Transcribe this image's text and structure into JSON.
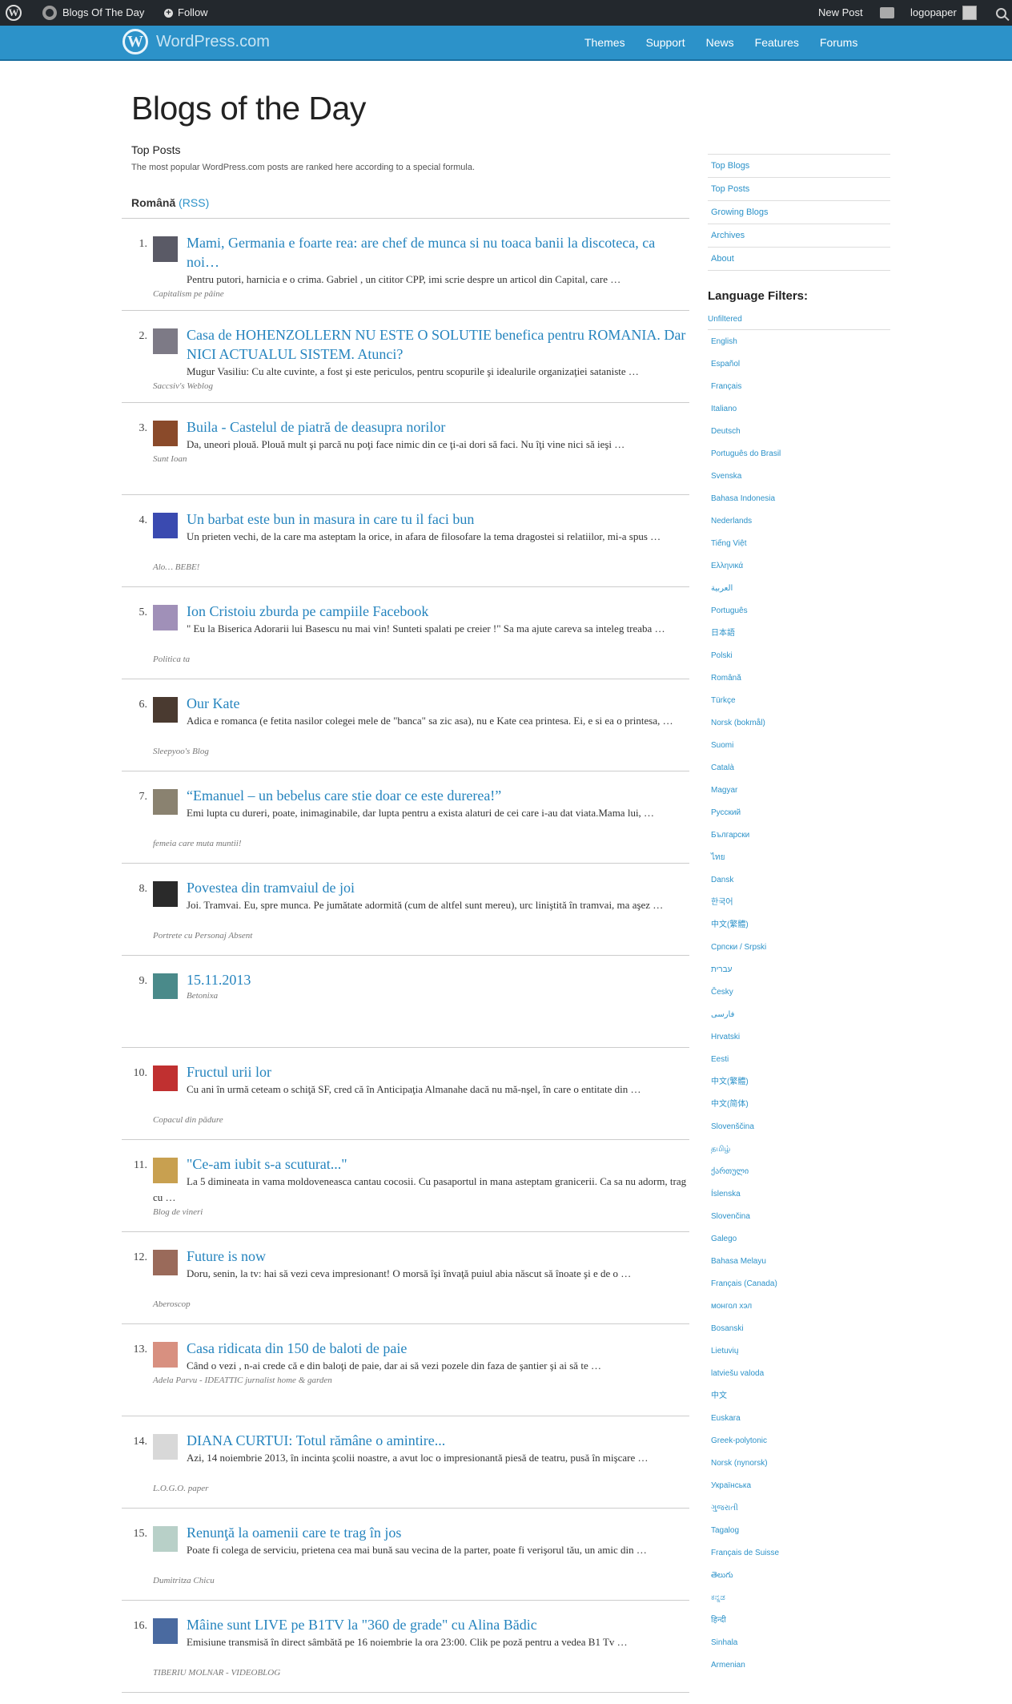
{
  "adminbar": {
    "site_name": "Blogs Of The Day",
    "follow": "Follow",
    "new_post": "New Post",
    "username": "logopaper"
  },
  "masthead": {
    "brand": "WordPress.com",
    "nav": [
      "Themes",
      "Support",
      "News",
      "Features",
      "Forums"
    ]
  },
  "main": {
    "title": "Blogs of the Day",
    "section_title": "Top Posts",
    "section_desc": "The most popular WordPress.com posts are ranked here according to a special formula.",
    "language": "Română",
    "rss": "(RSS)"
  },
  "colors": {
    "accent": "#2c92c9",
    "adminbar": "#23282d",
    "link": "#2584be"
  },
  "posts": [
    {
      "num": "1.",
      "title": "Mami, Germania e foarte rea: are chef de munca si nu toaca banii la discoteca, ca noi…",
      "excerpt": "Pentru putori, harnicia e o crima. Gabriel , un cititor CPP, imi scrie despre un articol din Capital, care …",
      "blog": "Capitalism pe pâine",
      "thumb": "#5a5a66"
    },
    {
      "num": "2.",
      "title": "Casa de HOHENZOLLERN NU ESTE O SOLUTIE benefica pentru ROMANIA. Dar NICI ACTUALUL SISTEM. Atunci?",
      "excerpt": "Mugur Vasiliu: Cu alte cuvinte, a fost şi este periculos, pentru scopurile şi idealurile organizaţiei sataniste …",
      "blog": "Saccsiv's Weblog",
      "thumb": "#7d7a86"
    },
    {
      "num": "3.",
      "title": "Buila - Castelul de piatră de deasupra norilor",
      "excerpt": "Da, uneori plouă. Plouă mult şi parcă nu poţi face nimic din ce ţi-ai dori să faci. Nu îţi vine nici să ieşi …",
      "blog": "Sunt Ioan",
      "thumb": "#8a4a2a"
    },
    {
      "num": "4.",
      "title": "Un barbat este bun in masura in care tu il faci bun",
      "excerpt": "Un prieten vechi, de la care ma asteptam la orice, in afara de filosofare la tema dragostei si relatiilor, mi-a spus …",
      "blog": "Alo… BEBE!",
      "thumb": "#3a4ab0"
    },
    {
      "num": "5.",
      "title": "Ion Cristoiu zburda pe campiile Facebook",
      "excerpt": " \" Eu la Biserica Adorarii lui Basescu nu mai vin! Sunteti spalati pe creier !\" Sa ma ajute careva sa inteleg treaba …",
      "blog": "Politica ta",
      "thumb": "#a090b8"
    },
    {
      "num": "6.",
      "title": "Our Kate",
      "excerpt": "Adica e romanca (e fetita nasilor colegei mele de \"banca\" sa zic asa), nu e Kate cea printesa. Ei, e si ea o printesa, …",
      "blog": "Sleepyoo's Blog",
      "thumb": "#4a3a30"
    },
    {
      "num": "7.",
      "title": "“Emanuel – un bebelus care stie doar ce este durerea!”",
      "excerpt": "Emi lupta cu dureri, poate, inimaginabile, dar lupta pentru a exista alaturi de cei care i-au dat viata.Mama lui, …",
      "blog": "femeia care muta muntii!",
      "thumb": "#8a8270"
    },
    {
      "num": "8.",
      "title": "Povestea din tramvaiul de joi",
      "excerpt": "Joi. Tramvai. Eu, spre munca. Pe jumătate adormită (cum de altfel sunt mereu), urc liniştită în tramvai, ma aşez …",
      "blog": "Portrete cu Personaj Absent",
      "thumb": "#2a2a2a"
    },
    {
      "num": "9.",
      "title": "15.11.2013",
      "excerpt": "",
      "blog": "Betonixa",
      "thumb": "#4a8a8a"
    },
    {
      "num": "10.",
      "title": "Fructul urii lor",
      "excerpt": "Cu ani în urmă ceteam o schiţă SF, cred că în Anticipaţia Almanahe dacă nu mă-nşel, în care o entitate din …",
      "blog": "Copacul din pădure",
      "thumb": "#c03030"
    },
    {
      "num": "11.",
      "title": "\"Ce-am iubit s-a scuturat...\"",
      "excerpt": "La 5 dimineata in vama moldoveneasca cantau cocosii. Cu pasaportul in mana asteptam granicerii. Ca sa nu adorm, trag cu …",
      "blog": "Blog de vineri",
      "thumb": "#c8a050"
    },
    {
      "num": "12.",
      "title": "Future is now",
      "excerpt": "Doru, senin, la tv: hai să vezi ceva impresionant! O morsă îşi învaţă puiul abia născut să înoate şi e de o …",
      "blog": "Aberoscop",
      "thumb": "#9a6a5a"
    },
    {
      "num": "13.",
      "title": "Casa ridicata din 150 de baloti de paie",
      "excerpt": "Când o vezi , n-ai crede că e din baloţi de paie, dar ai să vezi pozele din faza de şantier şi ai să te …",
      "blog": "Adela Parvu - IDEATTIC jurnalist home & garden",
      "thumb": "#d89080"
    },
    {
      "num": "14.",
      "title": "DIANA CURTUI: Totul rămâne o amintire...",
      "excerpt": "Azi, 14 noiembrie 2013, în incinta şcolii noastre, a avut loc o impresionantă piesă de teatru, pusă în mişcare …",
      "blog": "L.O.G.O. paper",
      "thumb": "#d8d8d8"
    },
    {
      "num": "15.",
      "title": "Renunţă la oamenii care te trag în jos",
      "excerpt": "Poate fi colega de serviciu, prietena cea mai bună sau vecina de la parter, poate fi verişorul tău, un amic din …",
      "blog": "Dumitritza Chicu",
      "thumb": "#b8d0c8"
    },
    {
      "num": "16.",
      "title": "Mâine sunt LIVE pe B1TV la \"360 de grade\" cu Alina Bădic",
      "excerpt": "Emisiune transmisă în direct sâmbătă pe 16 noiembrie la ora 23:00. Clik pe poză pentru a vedea B1 Tv …",
      "blog": "TIBERIU MOLNAR - VIDEOBLOG",
      "thumb": "#4a6aa0"
    }
  ],
  "sidebar": {
    "nav": [
      "Top Blogs",
      "Top Posts",
      "Growing Blogs",
      "Archives",
      "About"
    ],
    "filters_title": "Language Filters:",
    "unfiltered": "Unfiltered",
    "languages": [
      "English",
      "Español",
      "Français",
      "Italiano",
      "Deutsch",
      "Português do Brasil",
      "Svenska",
      "Bahasa Indonesia",
      "Nederlands",
      "Tiếng Việt",
      "Ελληνικά",
      "العربية",
      "Português",
      "日本語",
      "Polski",
      "Română",
      "Türkçe",
      "Norsk (bokmål)",
      "Suomi",
      "Català",
      "Magyar",
      "Русский",
      "Български",
      "ไทย",
      "Dansk",
      "한국어",
      "中文(繁體)",
      "Српски / Srpski",
      "עברית",
      "Česky",
      "فارسی",
      "Hrvatski",
      "Eesti",
      "中文(繁體)",
      "中文(简体)",
      "Slovenščina",
      "தமிழ்",
      "ქართული",
      "Íslenska",
      "Slovenčina",
      "Galego",
      "Bahasa Melayu",
      "Français (Canada)",
      "монгол хэл",
      "Bosanski",
      "Lietuvių",
      "latviešu valoda",
      "中文",
      "Euskara",
      "Greek-polytonic",
      "Norsk (nynorsk)",
      "Українська",
      "ગુજરાતી",
      "Tagalog",
      "Français de Suisse",
      "తెలుగు",
      "ಕನ್ನಡ",
      "हिन्दी",
      "Sinhala",
      "Armenian"
    ]
  }
}
